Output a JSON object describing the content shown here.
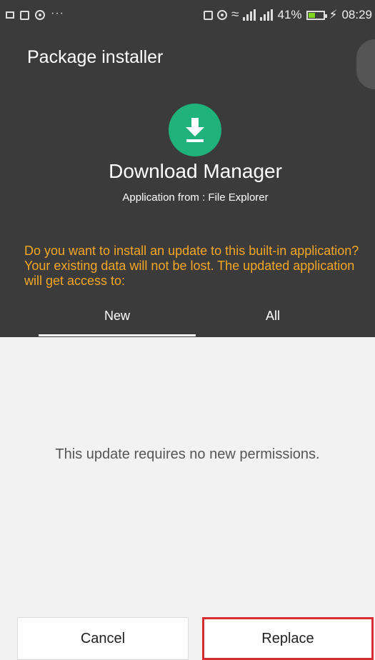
{
  "status_bar": {
    "battery": "41%",
    "time": "08:29",
    "battery_level": 0.41
  },
  "header": {
    "title": "Package installer"
  },
  "app": {
    "name": "Download Manager",
    "source": "Application from : File Explorer",
    "icon": "download-icon",
    "icon_color": "#1fb27a"
  },
  "prompt": {
    "message": "Do you want to install an update to this built-in application? Your existing data will not be lost. The updated application will get access to:",
    "color": "#f5a623"
  },
  "tabs": [
    {
      "label": "New",
      "selected": true
    },
    {
      "label": "All",
      "selected": false
    }
  ],
  "content": {
    "message": "This update requires no new permissions."
  },
  "buttons": {
    "cancel": "Cancel",
    "replace": "Replace",
    "highlight_color": "#d72b34"
  }
}
